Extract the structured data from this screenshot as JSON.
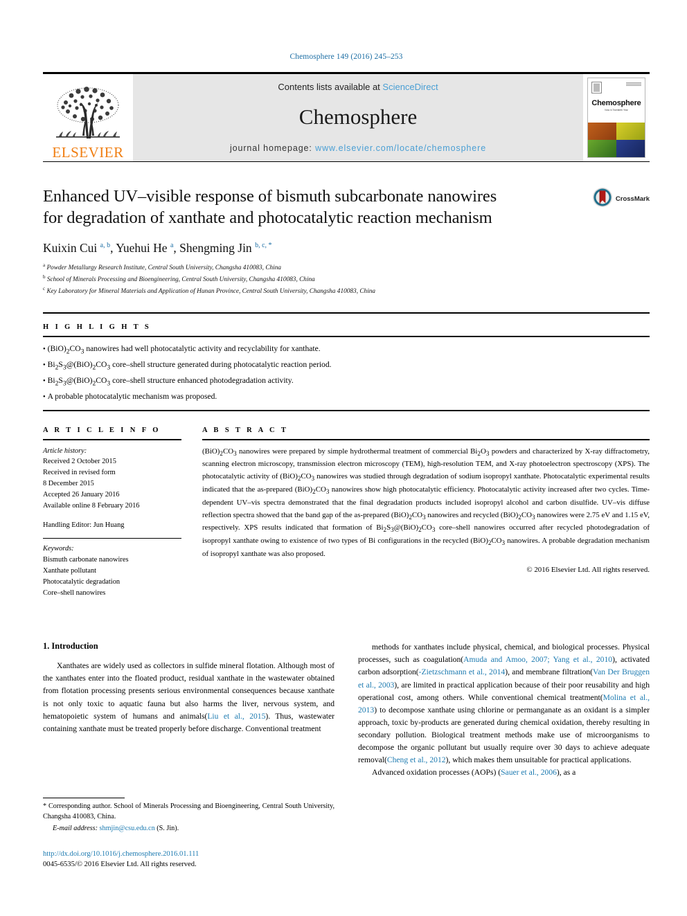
{
  "running_head": "Chemosphere 149 (2016) 245–253",
  "masthead": {
    "publisher_logo_word": "ELSEVIER",
    "contents_prefix": "Contents lists available at ",
    "contents_link": "ScienceDirect",
    "journal_name": "Chemosphere",
    "homepage_prefix": "journal homepage: ",
    "homepage_link": "www.elsevier.com/locate/chemosphere",
    "cover": {
      "title": "Chemosphere",
      "subtitle": "Now in Twentieth Year"
    }
  },
  "article": {
    "title_line1": "Enhanced UV–visible response of bismuth subcarbonate nanowires",
    "title_line2": "for degradation of xanthate and photocatalytic reaction mechanism",
    "crossmark_label": "CrossMark",
    "authors_html": "Kuixin Cui <sup>a, b</sup>, Yuehui He <sup>a</sup>, Shengming Jin <sup>b, c, *</sup>",
    "affiliations": [
      "Powder Metallurgy Research Institute, Central South University, Changsha 410083, China",
      "School of Minerals Processing and Bioengineering, Central South University, Changsha 410083, China",
      "Key Laboratory for Mineral Materials and Application of Hunan Province, Central South University, Changsha 410083, China"
    ],
    "affiliation_marks": [
      "a",
      "b",
      "c"
    ]
  },
  "highlights": {
    "heading": "H I G H L I G H T S",
    "items_html": [
      "(BiO)<sub>2</sub>CO<sub>3</sub> nanowires had well photocatalytic activity and recyclability for xanthate.",
      "Bi<sub>2</sub>S<sub>3</sub>@(BiO)<sub>2</sub>CO<sub>3</sub> core–shell structure generated during photocatalytic reaction period.",
      "Bi<sub>2</sub>S<sub>3</sub>@(BiO)<sub>2</sub>CO<sub>3</sub> core–shell structure enhanced photodegradation activity.",
      "A probable photocatalytic mechanism was proposed."
    ]
  },
  "article_info": {
    "heading": "A R T I C L E   I N F O",
    "history_label": "Article history:",
    "history": [
      "Received 2 October 2015",
      "Received in revised form",
      "8 December 2015",
      "Accepted 26 January 2016",
      "Available online 8 February 2016"
    ],
    "handling_editor": "Handling Editor: Jun Huang",
    "keywords_label": "Keywords:",
    "keywords": [
      "Bismuth carbonate nanowires",
      "Xanthate pollutant",
      "Photocatalytic degradation",
      "Core–shell nanowires"
    ]
  },
  "abstract": {
    "heading": "A B S T R A C T",
    "text_html": "(BiO)<sub>2</sub>CO<sub>3</sub> nanowires were prepared by simple hydrothermal treatment of commercial Bi<sub>2</sub>O<sub>3</sub> powders and characterized by X-ray diffractometry, scanning electron microscopy, transmission electron microscopy (TEM), high-resolution TEM, and X-ray photoelectron spectroscopy (XPS). The photocatalytic activity of (BiO)<sub>2</sub>CO<sub>3</sub> nanowires was studied through degradation of sodium isopropyl xanthate. Photocatalytic experimental results indicated that the as-prepared (BiO)<sub>2</sub>CO<sub>3</sub> nanowires show high photocatalytic efficiency. Photocatalytic activity increased after two cycles. Time-dependent UV–vis spectra demonstrated that the final degradation products included isopropyl alcohol and carbon disulfide. UV–vis diffuse reflection spectra showed that the band gap of the as-prepared (BiO)<sub>2</sub>CO<sub>3</sub> nanowires and recycled (BiO)<sub>2</sub>CO<sub>3</sub> nanowires were 2.75 eV and 1.15 eV, respectively. XPS results indicated that formation of Bi<sub>2</sub>S<sub>3</sub>@(BiO)<sub>2</sub>CO<sub>3</sub> core–shell nanowires occurred after recycled photodegradation of isopropyl xanthate owing to existence of two types of Bi configurations in the recycled (BiO)<sub>2</sub>CO<sub>3</sub> nanowires. A probable degradation mechanism of isopropyl xanthate was also proposed.",
    "copyright": "© 2016 Elsevier Ltd. All rights reserved."
  },
  "body": {
    "section_heading": "1. Introduction",
    "left_para_html": "Xanthates are widely used as collectors in sulfide mineral flotation. Although most of the xanthates enter into the floated product, residual xanthate in the wastewater obtained from flotation processing presents serious environmental consequences because xanthate is not only toxic to aquatic fauna but also harms the liver, nervous system, and hematopoietic system of humans and animals(<span class=\"cite\">Liu et al., 2015</span>). Thus, wastewater containing xanthate must be treated properly before discharge. Conventional treatment",
    "right_para1_html": "methods for xanthates include physical, chemical, and biological processes. Physical processes, such as coagulation(<span class=\"cite\">Amuda and Amoo, 2007; Yang et al., 2010</span>), activated carbon adsorption(<span class=\"cite\">-Zietzschmann et al., 2014</span>), and membrane filtration(<span class=\"cite\">Van Der Bruggen et al., 2003</span>), are limited in practical application because of their poor reusability and high operational cost, among others. While conventional chemical treatment(<span class=\"cite\">Molina et al., 2013</span>) to decompose xanthate using chlorine or permanganate as an oxidant is a simpler approach, toxic by-products are generated during chemical oxidation, thereby resulting in secondary pollution. Biological treatment methods make use of microorganisms to decompose the organic pollutant but usually require over 30 days to achieve adequate removal(<span class=\"cite\">Cheng et al., 2012</span>), which makes them unsuitable for practical applications.",
    "right_para2_html": "Advanced oxidation processes (AOPs) (<span class=\"cite\">Sauer et al., 2006</span>), as a"
  },
  "footnote": {
    "corresponding_html": "* Corresponding author. School of Minerals Processing and Bioengineering, Central South University, Changsha 410083, China.",
    "email_label": "E-mail address:",
    "email": "shmjin@csu.edu.cn",
    "email_suffix": "(S. Jin)."
  },
  "doi_block": {
    "doi_url": "http://dx.doi.org/10.1016/j.chemosphere.2016.01.111",
    "issn_line": "0045-6535/© 2016 Elsevier Ltd. All rights reserved."
  }
}
